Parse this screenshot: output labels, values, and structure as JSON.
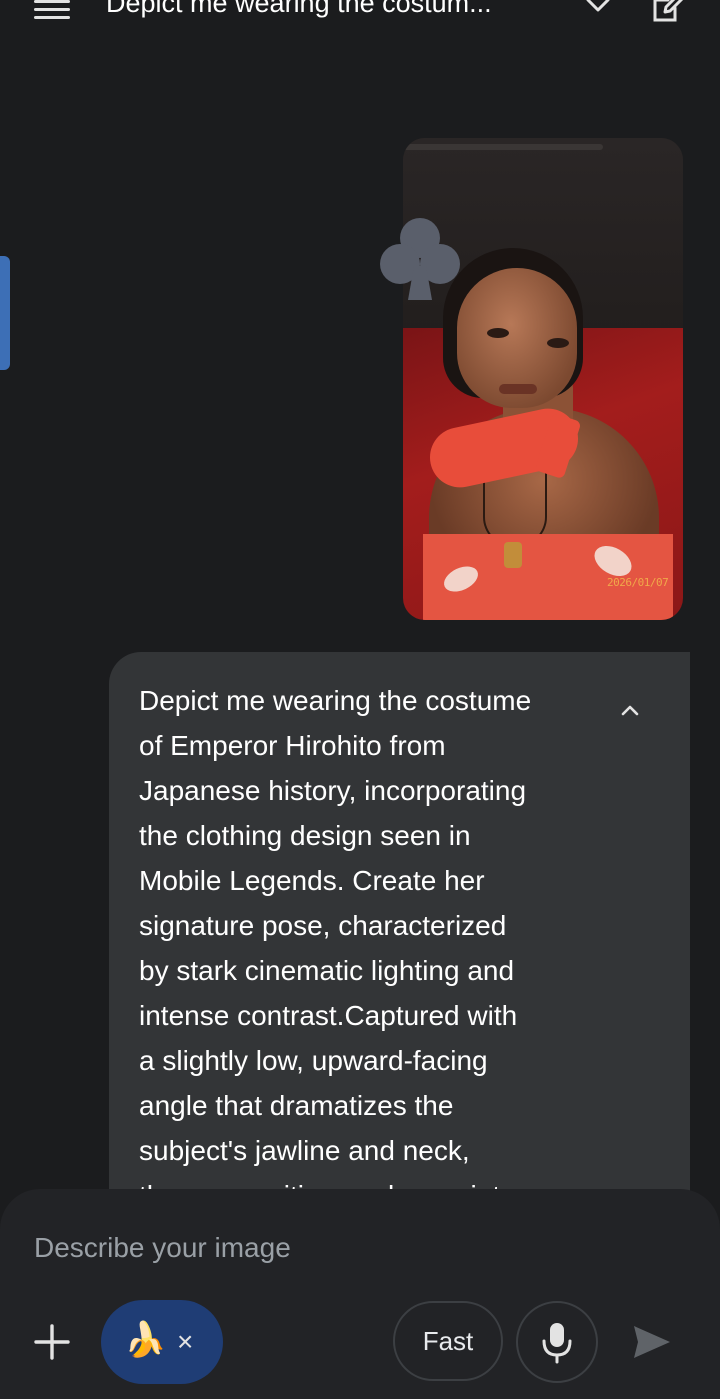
{
  "header": {
    "title": "Depict me wearing the costum...",
    "icons": [
      "menu-icon",
      "chevron-down-icon",
      "edit-icon"
    ]
  },
  "photo": {
    "date_stamp": "2026/01/07",
    "overlay_icon": "club-icon"
  },
  "message": {
    "lines": [
      "Depict me wearing the costume",
      "of Emperor Hirohito from",
      "Japanese history, incorporating",
      "the clothing design seen in",
      "Mobile Legends. Create her",
      "signature pose, characterized",
      "by stark cinematic lighting and",
      "intense contrast.Captured with",
      "a slightly low, upward-facing",
      "angle that dramatizes the",
      "subject's jawline and neck,",
      "the composition evokes quiet"
    ],
    "collapse_icon": "chevron-up-icon"
  },
  "composer": {
    "placeholder": "Describe your image",
    "chip_emoji": "🍌",
    "chip_close": "×",
    "mode_label": "Fast",
    "icons": [
      "plus-icon",
      "mic-icon",
      "send-icon"
    ]
  },
  "colors": {
    "background": "#1b1c1e",
    "bubble": "#333537",
    "composer": "#222326",
    "chip": "#1f3d75",
    "side_handle": "#3d6fb6"
  }
}
